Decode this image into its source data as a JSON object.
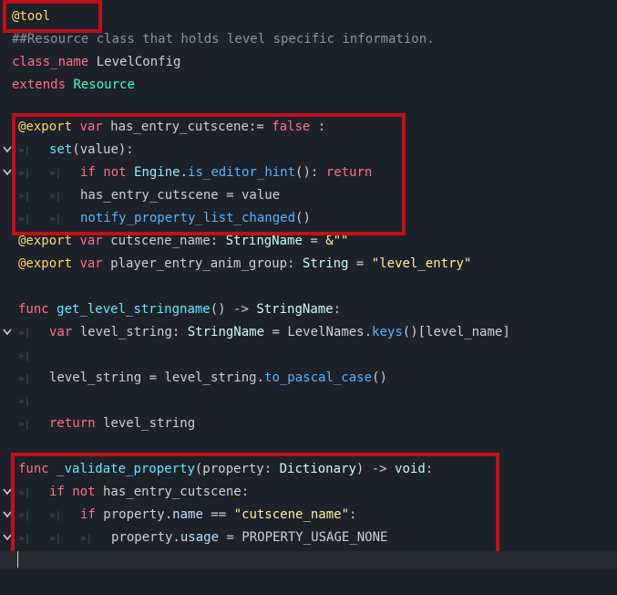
{
  "lines": [
    {
      "k": "l0",
      "segs": [
        [
          "an",
          "@tool"
        ]
      ]
    },
    {
      "k": "l1",
      "segs": [
        [
          "cm",
          "##Resource class that holds level specific information."
        ]
      ]
    },
    {
      "k": "l2",
      "segs": [
        [
          "kw",
          "class_name"
        ],
        [
          "pl",
          " LevelConfig"
        ]
      ]
    },
    {
      "k": "l3",
      "segs": [
        [
          "kw",
          "extends"
        ],
        [
          "pl",
          " "
        ],
        [
          "ty",
          "Resource"
        ]
      ]
    },
    {
      "k": "l5",
      "segs": [
        [
          "an",
          "@export"
        ],
        [
          "pl",
          " "
        ],
        [
          "kw",
          "var"
        ],
        [
          "pl",
          " has_entry_cutscene:= "
        ],
        [
          "bl",
          "false"
        ],
        [
          "pl",
          " :"
        ]
      ]
    },
    {
      "k": "l6",
      "segs": [
        [
          "fd",
          "set"
        ],
        [
          "pl",
          "(value):"
        ]
      ]
    },
    {
      "k": "l7",
      "segs": [
        [
          "kw",
          "if not"
        ],
        [
          "pl",
          " "
        ],
        [
          "eg",
          "Engine"
        ],
        [
          "pl",
          "."
        ],
        [
          "fn",
          "is_editor_hint"
        ],
        [
          "pl",
          "(): "
        ],
        [
          "kw",
          "return"
        ]
      ]
    },
    {
      "k": "l8",
      "segs": [
        [
          "pl",
          "has_entry_cutscene = value"
        ]
      ]
    },
    {
      "k": "l9",
      "segs": [
        [
          "fn",
          "notify_property_list_changed"
        ],
        [
          "pl",
          "()"
        ]
      ]
    },
    {
      "k": "l10",
      "segs": [
        [
          "an",
          "@export"
        ],
        [
          "pl",
          " "
        ],
        [
          "kw",
          "var"
        ],
        [
          "pl",
          " cutscene_name: "
        ],
        [
          "ct",
          "StringName"
        ],
        [
          "pl",
          " = "
        ],
        [
          "st",
          "&\"\""
        ]
      ]
    },
    {
      "k": "l11",
      "segs": [
        [
          "an",
          "@export"
        ],
        [
          "pl",
          " "
        ],
        [
          "kw",
          "var"
        ],
        [
          "pl",
          " player_entry_anim_group: "
        ],
        [
          "ct",
          "String"
        ],
        [
          "pl",
          " = "
        ],
        [
          "st",
          "\"level_entry\""
        ]
      ]
    },
    {
      "k": "l13",
      "segs": [
        [
          "kw",
          "func"
        ],
        [
          "pl",
          " "
        ],
        [
          "fd",
          "get_level_stringname"
        ],
        [
          "pl",
          "() -> "
        ],
        [
          "ct",
          "StringName"
        ],
        [
          "pl",
          ":"
        ]
      ]
    },
    {
      "k": "l14",
      "segs": [
        [
          "kw",
          "var"
        ],
        [
          "pl",
          " level_string: "
        ],
        [
          "ct",
          "StringName"
        ],
        [
          "pl",
          " = LevelNames."
        ],
        [
          "fn",
          "keys"
        ],
        [
          "pl",
          "()[level_name]"
        ]
      ]
    },
    {
      "k": "l16",
      "segs": [
        [
          "pl",
          "level_string = level_string."
        ],
        [
          "fn",
          "to_pascal_case"
        ],
        [
          "pl",
          "()"
        ]
      ]
    },
    {
      "k": "l18",
      "segs": [
        [
          "kw",
          "return"
        ],
        [
          "pl",
          " level_string"
        ]
      ]
    },
    {
      "k": "l20",
      "segs": [
        [
          "kw",
          "func"
        ],
        [
          "pl",
          " "
        ],
        [
          "fd",
          "_validate_property"
        ],
        [
          "pl",
          "(property: "
        ],
        [
          "ct",
          "Dictionary"
        ],
        [
          "pl",
          ") -> "
        ],
        [
          "ct",
          "void"
        ],
        [
          "pl",
          ":"
        ]
      ]
    },
    {
      "k": "l21",
      "segs": [
        [
          "kw",
          "if not"
        ],
        [
          "pl",
          " has_entry_cutscene:"
        ]
      ]
    },
    {
      "k": "l22",
      "segs": [
        [
          "kw",
          "if"
        ],
        [
          "pl",
          " property."
        ],
        [
          "pr",
          "name"
        ],
        [
          "pl",
          " == "
        ],
        [
          "st",
          "\"cutscene_name\""
        ],
        [
          "pl",
          ":"
        ]
      ]
    },
    {
      "k": "l23",
      "segs": [
        [
          "pl",
          "property."
        ],
        [
          "pr",
          "usage"
        ],
        [
          "pl",
          " = PROPERTY_USAGE_NONE"
        ]
      ]
    }
  ],
  "tab_glyph": "»|"
}
